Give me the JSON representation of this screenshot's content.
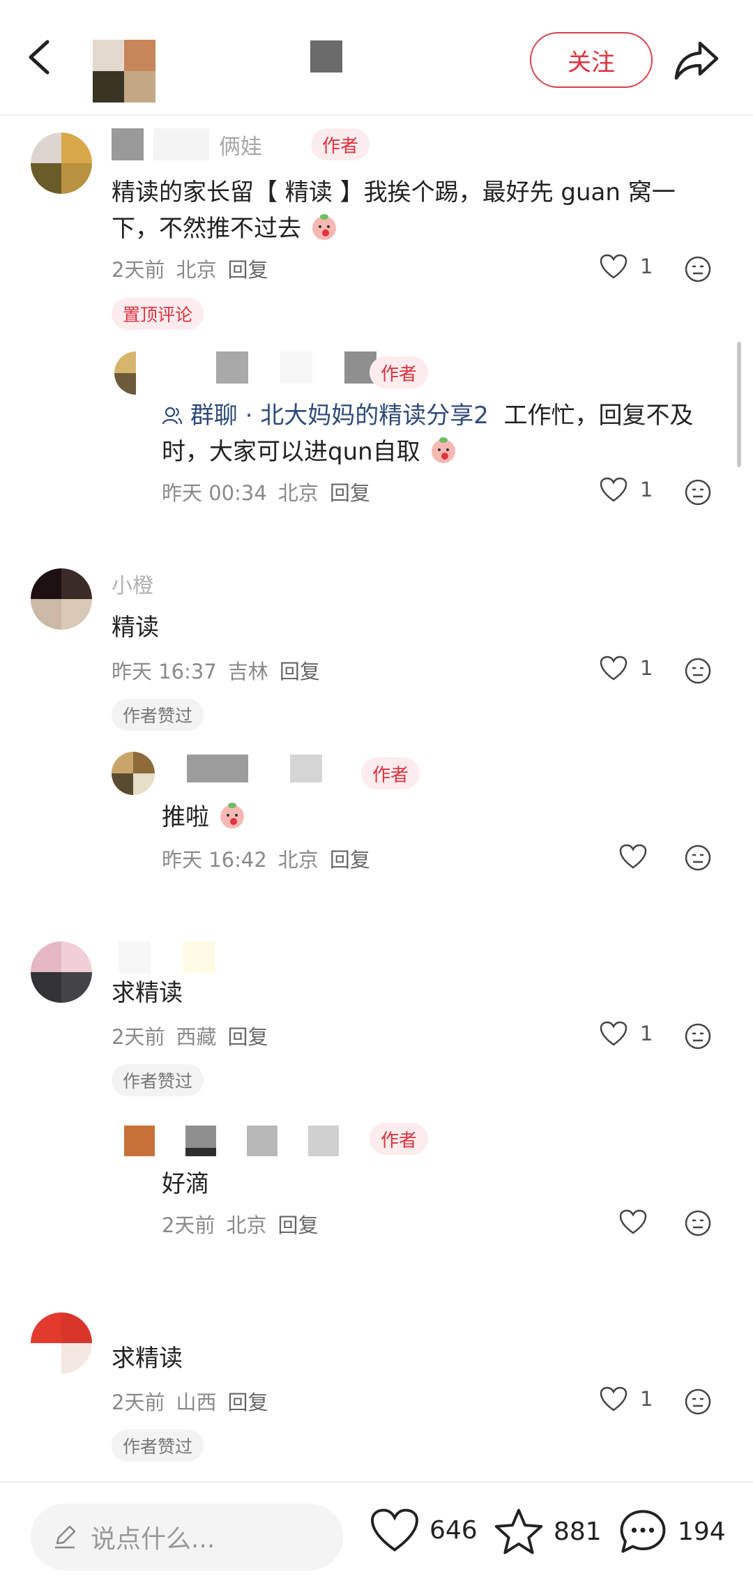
{
  "header": {
    "follow_label": "关注"
  },
  "comments": [
    {
      "name_visible": "俩娃",
      "is_author": true,
      "author_tag": "作者",
      "text": "精读的家长留【 精读 】我挨个踢，最好先 guan 窝一下，不然推不过去",
      "time": "2天前",
      "location": "北京",
      "reply_label": "回复",
      "likes": "1",
      "badge": "置顶评论",
      "replies": [
        {
          "is_author": true,
          "author_tag": "作者",
          "group_link": "群聊 · 北大妈妈的精读分享2",
          "text": "工作忙，回复不及时，大家可以进qun自取",
          "time": "昨天 00:34",
          "location": "北京",
          "reply_label": "回复",
          "likes": "1"
        }
      ]
    },
    {
      "name_visible": "小橙",
      "text": "精读",
      "time": "昨天 16:37",
      "location": "吉林",
      "reply_label": "回复",
      "likes": "1",
      "badge": "作者赞过",
      "replies": [
        {
          "is_author": true,
          "author_tag": "作者",
          "text": "推啦",
          "time": "昨天 16:42",
          "location": "北京",
          "reply_label": "回复",
          "likes": ""
        }
      ]
    },
    {
      "text": "求精读",
      "time": "2天前",
      "location": "西藏",
      "reply_label": "回复",
      "likes": "1",
      "badge": "作者赞过",
      "replies": [
        {
          "is_author": true,
          "author_tag": "作者",
          "text": "好滴",
          "time": "2天前",
          "location": "北京",
          "reply_label": "回复",
          "likes": ""
        }
      ]
    },
    {
      "text": "求精读",
      "time": "2天前",
      "location": "山西",
      "reply_label": "回复",
      "likes": "1",
      "badge": "作者赞过"
    }
  ],
  "bottom_bar": {
    "input_placeholder": "说点什么...",
    "likes_count": "646",
    "favorites_count": "881",
    "comments_count": "194"
  },
  "colors": {
    "accent": "#e0323f",
    "link": "#2f4a7a",
    "meta": "#8a8a8a"
  },
  "icons": [
    "back-icon",
    "share-icon",
    "heart-icon",
    "face-icon",
    "edit-icon",
    "star-icon",
    "chat-bubble-icon",
    "group-icon",
    "emoji-icon"
  ]
}
